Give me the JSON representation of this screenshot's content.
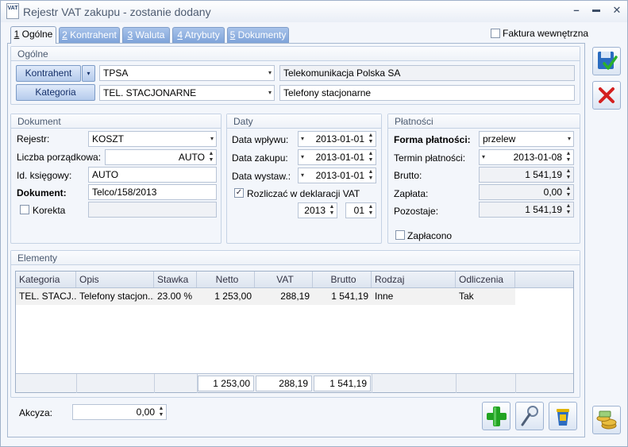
{
  "window": {
    "app_icon_text": "VAT",
    "title": "Rejestr VAT zakupu - zostanie dodany",
    "minimize": "–",
    "maximize": "▬",
    "close": "✕"
  },
  "tabs": [
    {
      "num": "1",
      "label": " Ogólne"
    },
    {
      "num": "2",
      "label": " Kontrahent"
    },
    {
      "num": "3",
      "label": " Waluta"
    },
    {
      "num": "4",
      "label": " Atrybuty"
    },
    {
      "num": "5",
      "label": " Dokumenty"
    }
  ],
  "faktura_wewnetrzna": {
    "label": "Faktura wewnętrzna",
    "checked": false
  },
  "ogolne": {
    "header": "Ogólne",
    "kontrahent_button": "Kontrahent",
    "kontrahent_code": "TPSA",
    "kontrahent_name": "Telekomunikacja Polska SA",
    "kategoria_button": "Kategoria",
    "kategoria_code": "TEL. STACJONARNE",
    "kategoria_name": "Telefony stacjonarne"
  },
  "dokument": {
    "header": "Dokument",
    "rejestr_label": "Rejestr:",
    "rejestr_value": "KOSZT",
    "liczba_label": "Liczba porządkowa:",
    "liczba_value": "AUTO",
    "id_label": "Id. księgowy:",
    "id_value": "AUTO",
    "dokument_label": "Dokument:",
    "dokument_value": "Telco/158/2013",
    "korekta_label": "Korekta",
    "korekta_value": ""
  },
  "daty": {
    "header": "Daty",
    "wplywu_label": "Data wpływu:",
    "wplywu_value": "2013-01-01",
    "zakupu_label": "Data zakupu:",
    "zakupu_value": "2013-01-01",
    "wystaw_label": "Data wystaw.:",
    "wystaw_value": "2013-01-01",
    "rozliczac_label": "Rozliczać w deklaracji VAT",
    "rozliczac_checked": "✓",
    "rok": "2013",
    "miesiac": "01"
  },
  "platnosci": {
    "header": "Płatności",
    "forma_label": "Forma płatności:",
    "forma_value": "przelew",
    "termin_label": "Termin płatności:",
    "termin_value": "2013-01-08",
    "brutto_label": "Brutto:",
    "brutto_value": "1 541,19",
    "zaplata_label": "Zapłata:",
    "zaplata_value": "0,00",
    "pozostaje_label": "Pozostaje:",
    "pozostaje_value": "1 541,19",
    "zaplacono_label": "Zapłacono"
  },
  "elementy": {
    "header": "Elementy",
    "columns": [
      "Kategoria",
      "Opis",
      "Stawka",
      "Netto",
      "VAT",
      "Brutto",
      "Rodzaj",
      "Odliczenia"
    ],
    "rows": [
      [
        "TEL. STACJ...",
        "Telefony stacjon...",
        "23.00 %",
        "1 253,00",
        "288,19",
        "1 541,19",
        "Inne",
        "Tak"
      ]
    ],
    "totals": {
      "netto": "1 253,00",
      "vat": "288,19",
      "brutto": "1 541,19"
    }
  },
  "akcyza": {
    "label": "Akcyza:",
    "value": "0,00"
  },
  "icons": {
    "dropdown": "▾",
    "spin_up": "▲",
    "spin_down": "▼",
    "dropdown_left": "▾"
  },
  "colors": {
    "accent": "#7ea3d9",
    "save": "#2a6cc0",
    "cancel": "#d42020",
    "add": "#2bb02b"
  }
}
